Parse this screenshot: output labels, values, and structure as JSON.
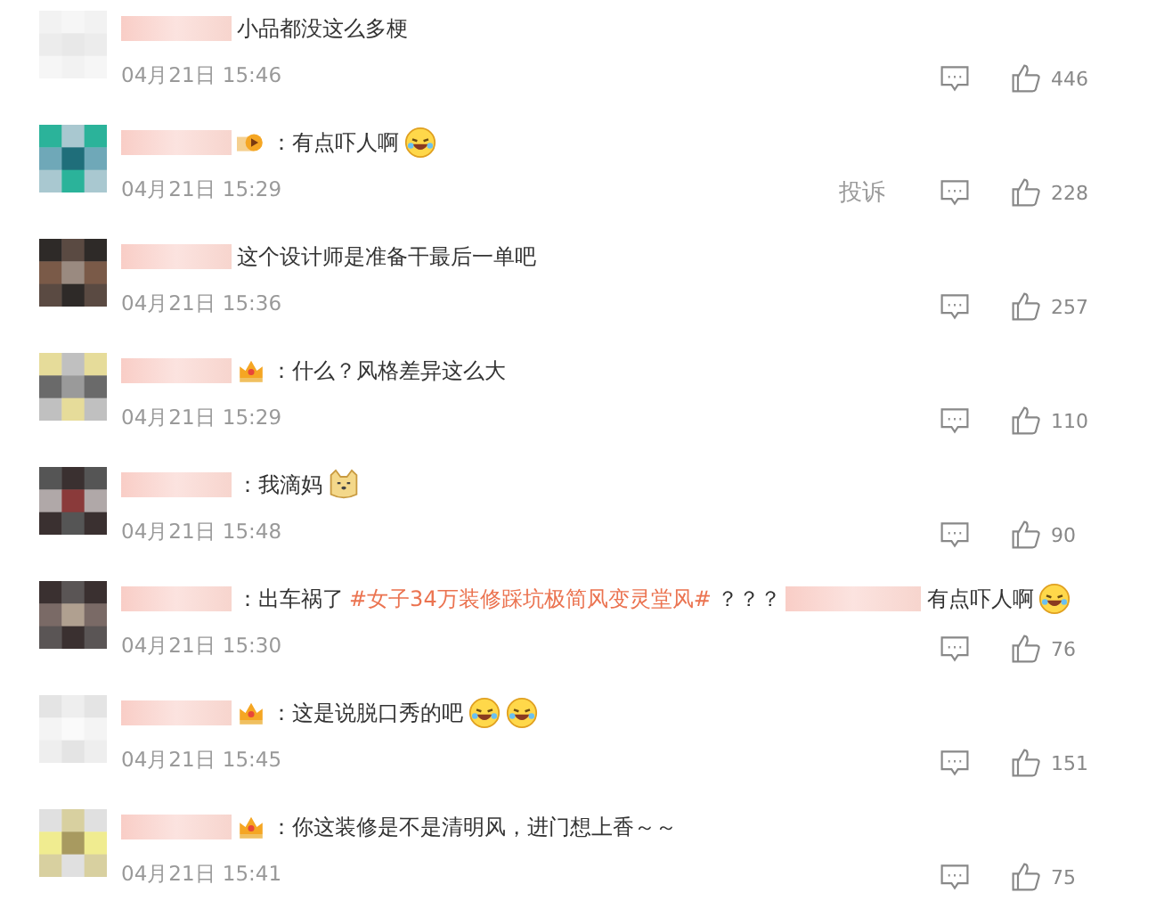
{
  "comments": [
    {
      "content": [
        {
          "kind": "text",
          "text": "小品都没这么多梗"
        }
      ],
      "time": "04月21日 15:46",
      "likes": "446"
    },
    {
      "badge": {
        "kind": "vip"
      },
      "content": [
        {
          "kind": "text",
          "text": "：有点吓人啊"
        },
        {
          "kind": "laugh-emoji"
        }
      ],
      "time": "04月21日 15:29",
      "report": "投诉",
      "likes": "228"
    },
    {
      "content": [
        {
          "kind": "text",
          "text": "这个设计师是准备干最后一单吧"
        }
      ],
      "time": "04月21日 15:36",
      "likes": "257"
    },
    {
      "badge": {
        "kind": "crown"
      },
      "content": [
        {
          "kind": "text",
          "text": "：什么？风格差异这么大"
        }
      ],
      "time": "04月21日 15:29",
      "likes": "110"
    },
    {
      "content": [
        {
          "kind": "text",
          "text": "：我滴妈"
        },
        {
          "kind": "doge-emoji"
        }
      ],
      "time": "04月21日 15:48",
      "likes": "90"
    },
    {
      "content": [
        {
          "kind": "text",
          "text": "：出车祸了"
        },
        {
          "kind": "topic",
          "text": "#女子34万装修踩坑极简风变灵堂风#"
        },
        {
          "kind": "text",
          "text": "？？？"
        },
        {
          "kind": "mention"
        },
        {
          "kind": "text",
          "text": "有点吓人啊"
        },
        {
          "kind": "laugh-emoji"
        }
      ],
      "time": "04月21日 15:30",
      "likes": "76"
    },
    {
      "badge": {
        "kind": "crown"
      },
      "content": [
        {
          "kind": "text",
          "text": "：这是说脱口秀的吧"
        },
        {
          "kind": "laugh-emoji"
        },
        {
          "kind": "laugh-emoji"
        }
      ],
      "time": "04月21日 15:45",
      "likes": "151"
    },
    {
      "badge": {
        "kind": "crown"
      },
      "content": [
        {
          "kind": "text",
          "text": "：你这装修是不是清明风，进门想上香～～"
        }
      ],
      "time": "04月21日 15:41",
      "likes": "75"
    }
  ]
}
